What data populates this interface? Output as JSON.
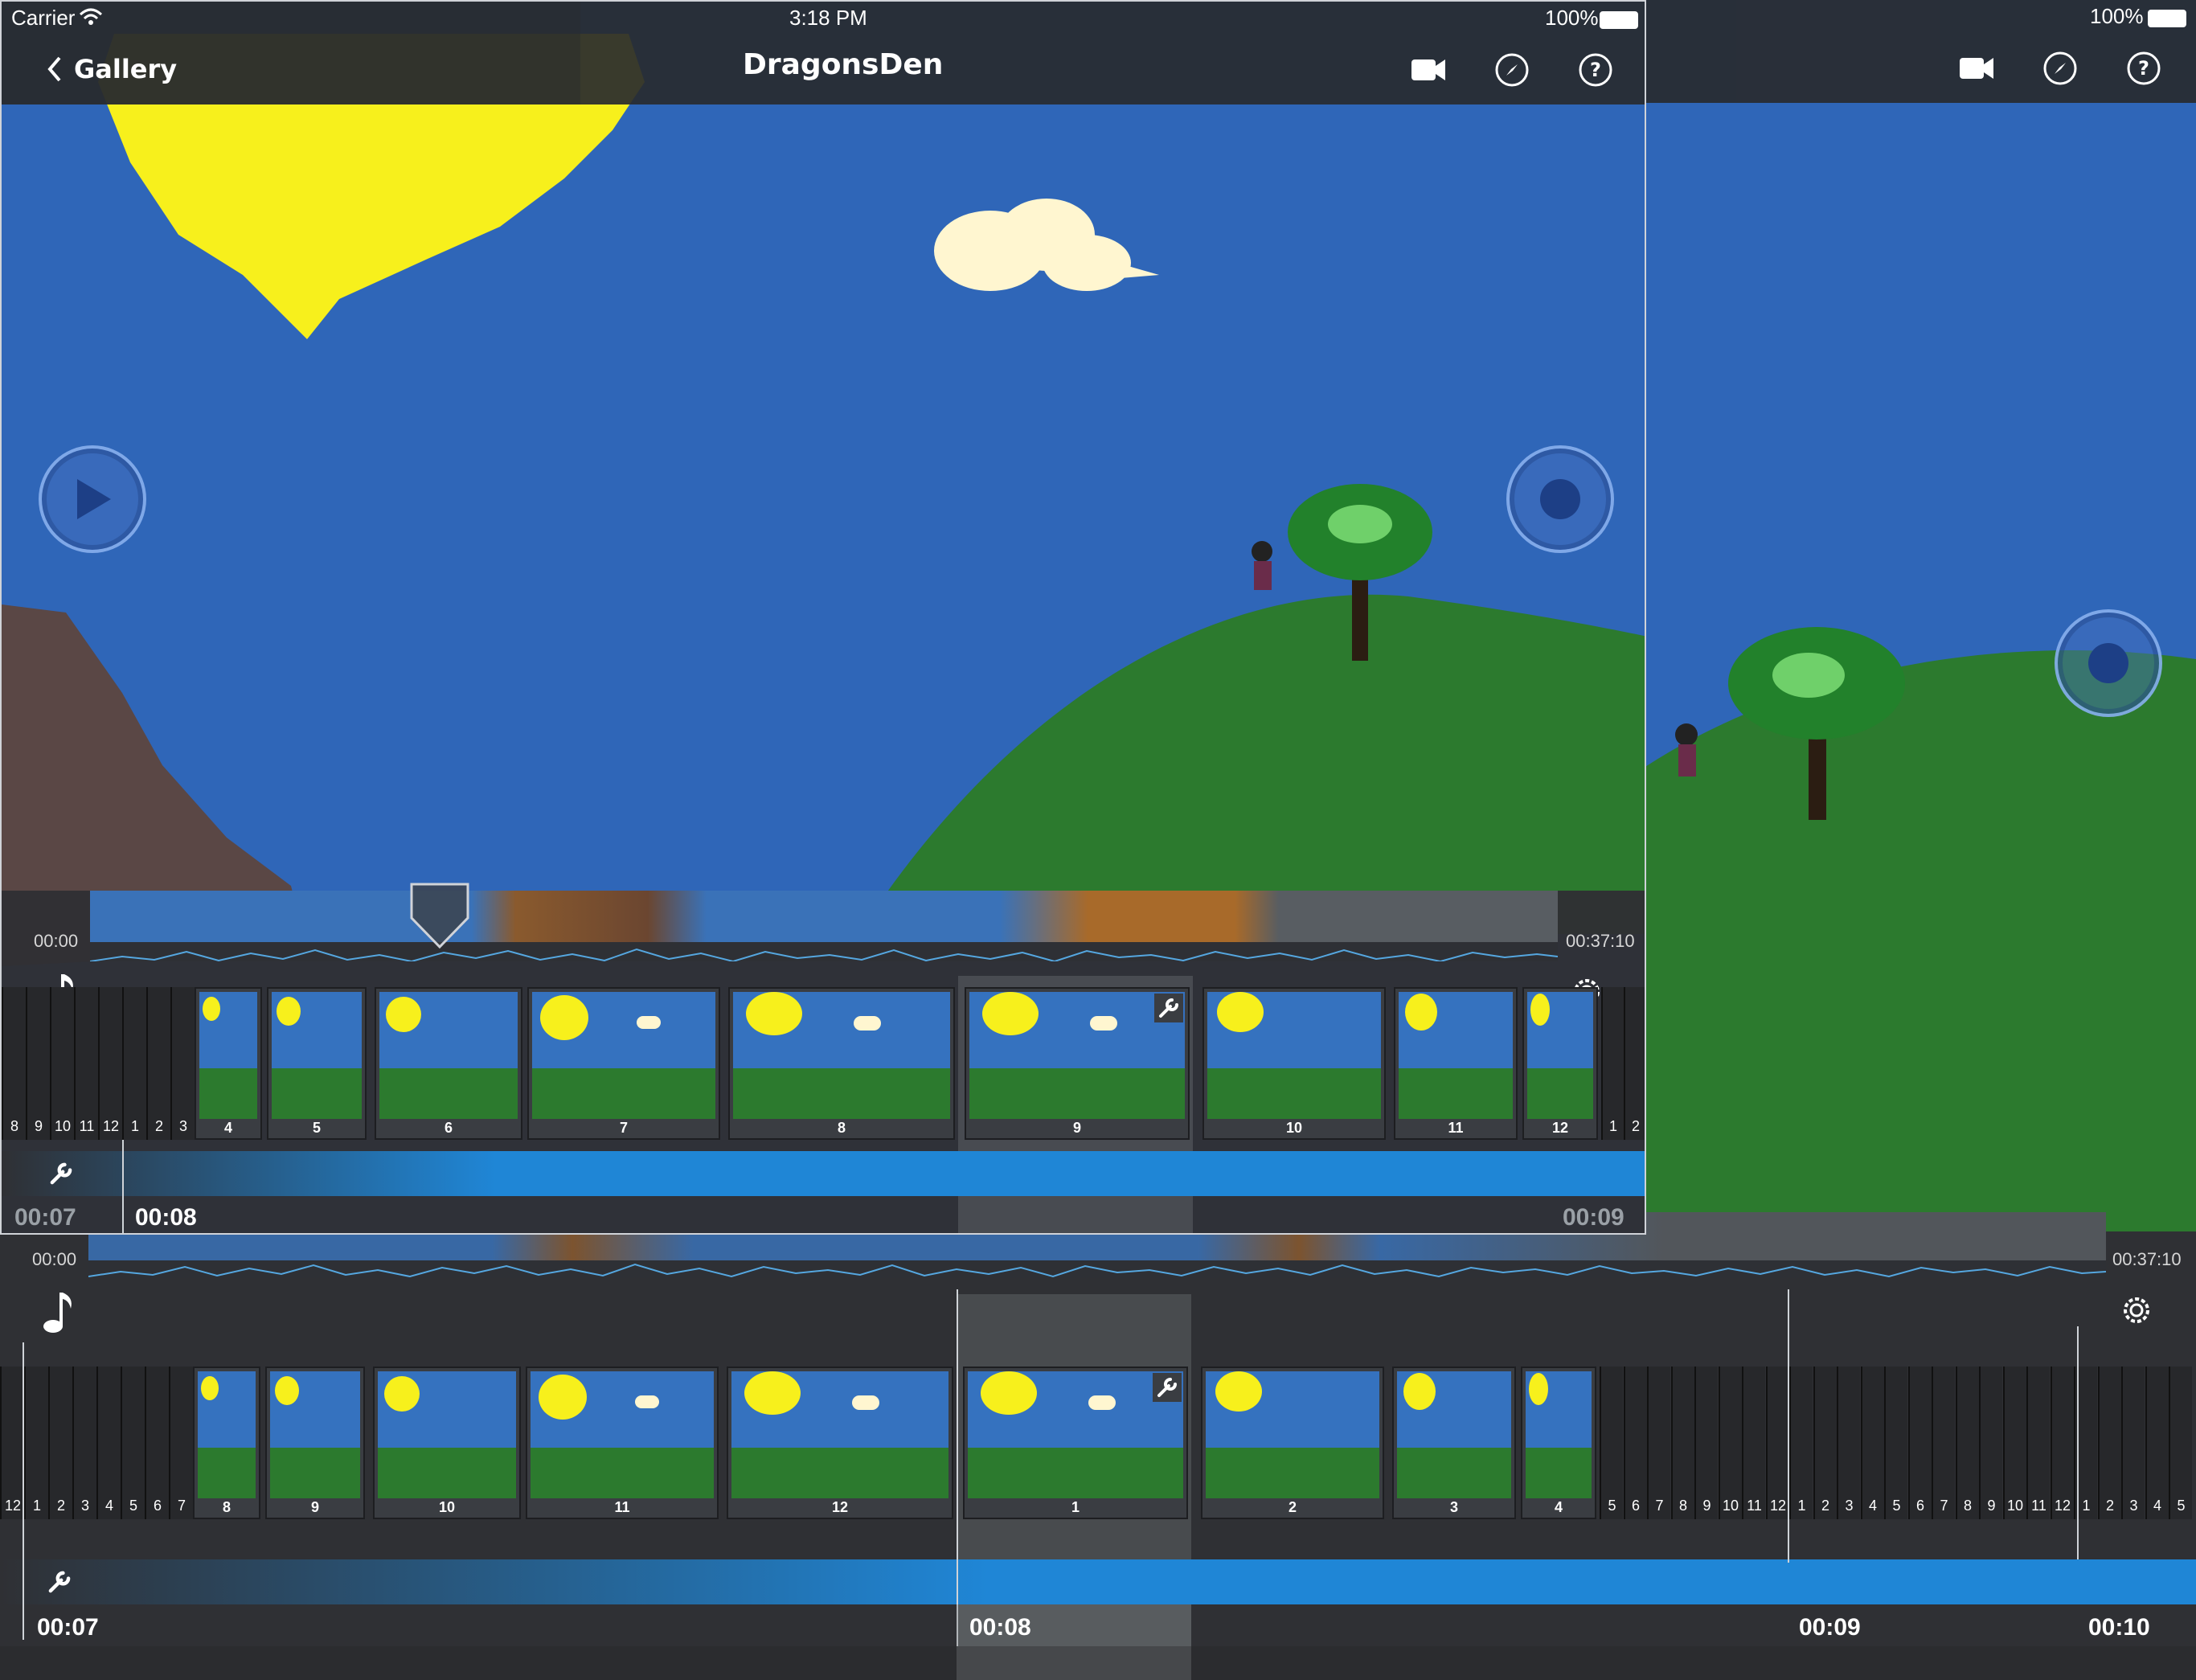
{
  "status": {
    "carrier": "Carrier",
    "time": "3:18 PM",
    "battery": "100%"
  },
  "nav": {
    "back_label": "Gallery",
    "title": "DragonsDen"
  },
  "icons": {
    "camera": "camera-icon",
    "compass": "compass-icon",
    "help": "help-icon",
    "music": "music-note-icon",
    "gear": "gear-icon",
    "wrench": "wrench-icon",
    "play": "play-icon",
    "record": "record-icon"
  },
  "colors": {
    "sky": "#2f66b8",
    "hill": "#2c7a2e",
    "sun": "#f7f01c",
    "audio": "#1f86d6",
    "panel": "#2f3034"
  },
  "top_view": {
    "timeline_start": "00:00",
    "timeline_end": "00:37:10",
    "frames_left": [
      "8",
      "9",
      "10",
      "11",
      "12",
      "1",
      "2",
      "3"
    ],
    "frames": [
      {
        "num": "4"
      },
      {
        "num": "5"
      },
      {
        "num": "6"
      },
      {
        "num": "7"
      },
      {
        "num": "8"
      },
      {
        "num": "9"
      },
      {
        "num": "10"
      },
      {
        "num": "11"
      },
      {
        "num": "12"
      }
    ],
    "frames_right": [
      "1",
      "2"
    ],
    "time_left": "00:07",
    "time_center": "00:08",
    "time_right": "00:09"
  },
  "bottom_view": {
    "timeline_start": "00:00",
    "timeline_end": "00:37:10",
    "frames_left": [
      "12",
      "1",
      "2",
      "3",
      "4",
      "5",
      "6",
      "7"
    ],
    "frames": [
      {
        "num": "8"
      },
      {
        "num": "9"
      },
      {
        "num": "10"
      },
      {
        "num": "11"
      },
      {
        "num": "12"
      },
      {
        "num": "1"
      },
      {
        "num": "2"
      },
      {
        "num": "3"
      },
      {
        "num": "4"
      }
    ],
    "frames_right": [
      "5",
      "6",
      "7",
      "8",
      "9",
      "10",
      "11",
      "12",
      "1",
      "2",
      "3",
      "4",
      "5",
      "6",
      "7",
      "8",
      "9",
      "10",
      "11",
      "12",
      "1",
      "2",
      "3",
      "4",
      "5"
    ],
    "time_left": "00:07",
    "time_center": "00:08",
    "time_mid": "00:09",
    "time_right": "00:10"
  }
}
